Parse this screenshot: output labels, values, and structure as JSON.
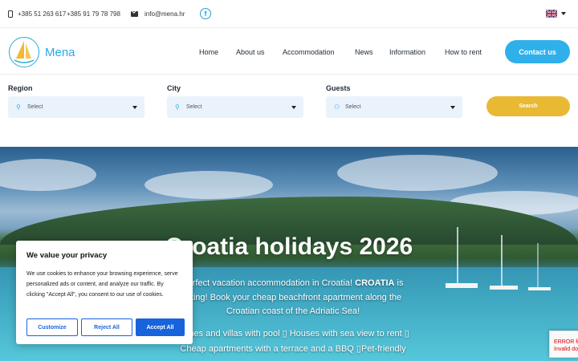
{
  "topbar": {
    "phone_1": "+385 51 263 617",
    "phone_2": "+385 91 79 78 798",
    "email": "info@mena.hr",
    "facebook_glyph": "f",
    "language_icon": "uk-flag-icon"
  },
  "nav": {
    "logo_text": "Mena",
    "links": [
      "Home",
      "About us",
      "Accommodation",
      "News",
      "Information",
      "How to rent"
    ],
    "contact_label": "Contact us"
  },
  "search": {
    "region_label": "Region",
    "region_value": "Select",
    "city_label": "City",
    "city_value": "Select",
    "guests_label": "Guests",
    "guests_value": "Select",
    "search_label": "Search"
  },
  "hero": {
    "title": "Croatia holidays 2026",
    "line_1_pre": "perfect vacation accommodation in Croatia! ",
    "line_1_bold": "CROATIA",
    "line_1_post": " is",
    "line_2": "citing! Book your cheap beachfront apartment along the",
    "line_3": "Croatian coast of the Adriatic Sea!",
    "line_4": "homes and villas with pool ▯ Houses with sea view to rent ▯",
    "line_5": "Cheap apartments with a terrace and a BBQ ▯Pet-friendly"
  },
  "cookie": {
    "title": "We value your privacy",
    "body": "We use cookies to enhance your browsing experience, serve personalized ads or content, and analyze our traffic. By clicking \"Accept All\", you consent to our use of cookies.",
    "customize": "Customize",
    "reject": "Reject All",
    "accept": "Accept All"
  },
  "recaptcha": {
    "line_1": "ERROR fo",
    "line_2": "Invalid do"
  },
  "colors": {
    "accent": "#2fb0ea",
    "search_button": "#e9b934",
    "cookie_button": "#1863dc"
  }
}
